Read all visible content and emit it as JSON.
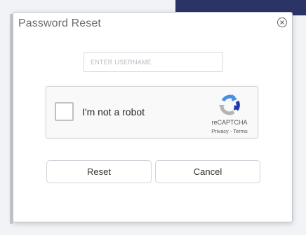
{
  "dialog": {
    "title": "Password Reset"
  },
  "username": {
    "placeholder": "ENTER USERNAME",
    "value": ""
  },
  "captcha": {
    "label": "I'm not a robot",
    "brand": "reCAPTCHA",
    "privacy": "Privacy",
    "separator": " - ",
    "terms": "Terms",
    "checked": false
  },
  "buttons": {
    "reset": "Reset",
    "cancel": "Cancel"
  },
  "icons": {
    "close": "close-icon",
    "captcha_logo": "recaptcha-logo-icon"
  },
  "colors": {
    "captcha_blue": "#4a90e2",
    "captcha_dark_blue": "#1c3aa9",
    "captcha_gray": "#b4b4b4",
    "header_band": "#2a3566"
  }
}
